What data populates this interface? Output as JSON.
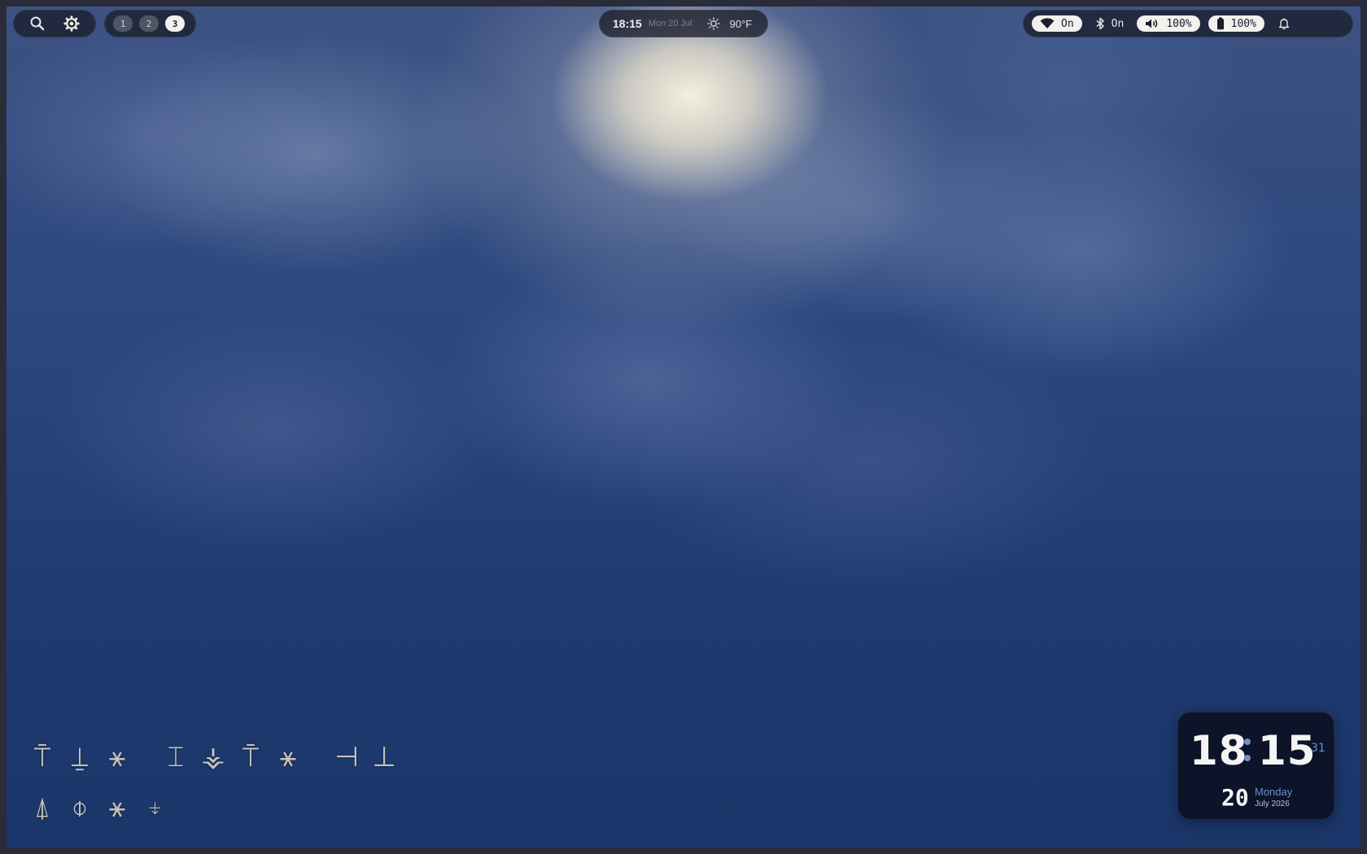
{
  "topbar": {
    "left": {
      "icons": [
        "search-icon",
        "settings-icon"
      ]
    },
    "workspaces": [
      {
        "label": "1",
        "active": false
      },
      {
        "label": "2",
        "active": false
      },
      {
        "label": "3",
        "active": true
      }
    ],
    "center": {
      "time": "18:15",
      "date": "Mon 20 Jul",
      "weather_icon": "sun-icon",
      "temperature": "90°F"
    },
    "status": {
      "wifi": {
        "icon": "wifi-icon",
        "label": "On"
      },
      "bluetooth": {
        "icon": "bluetooth-icon",
        "label": "On"
      },
      "volume": {
        "icon": "volume-icon",
        "label": "100%"
      },
      "battery": {
        "icon": "battery-icon",
        "label": "100%"
      },
      "notifications": {
        "icon": "bell-icon"
      }
    },
    "colors": {
      "bar": "#1a1e2a",
      "chip": "#f3f1ee",
      "accent": "#6f8fc7"
    }
  },
  "desktop_glyphs": {
    "row1": [
      "⍑",
      "⍊",
      "⚹",
      "⌶",
      "⚶",
      "⍑",
      "⚹",
      "⊣",
      "⊥"
    ],
    "row2": [
      "⍋",
      "⌽",
      "⚹",
      "⍖"
    ]
  },
  "clock_widget": {
    "hour": "18",
    "minute": "15",
    "seconds": "31",
    "day": "20",
    "weekday": "Monday",
    "month_year": "July 2026"
  }
}
